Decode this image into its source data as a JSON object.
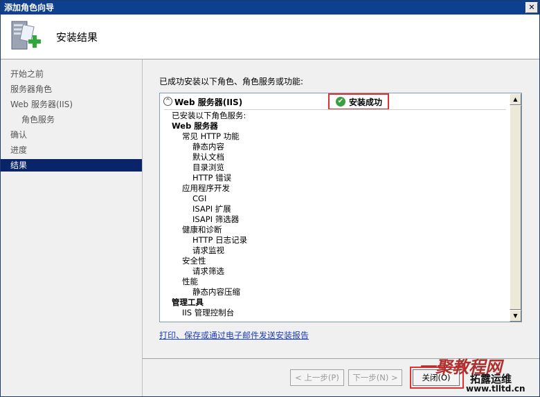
{
  "window": {
    "title": "添加角色向导",
    "close_glyph": "✕"
  },
  "header": {
    "title": "安装结果"
  },
  "sidebar": {
    "items": [
      {
        "label": "开始之前",
        "state": "normal",
        "indent": false
      },
      {
        "label": "服务器角色",
        "state": "normal",
        "indent": false
      },
      {
        "label": "Web 服务器(IIS)",
        "state": "normal",
        "indent": false
      },
      {
        "label": "角色服务",
        "state": "normal",
        "indent": true
      },
      {
        "label": "确认",
        "state": "normal",
        "indent": false
      },
      {
        "label": "进度",
        "state": "normal",
        "indent": false
      },
      {
        "label": "结果",
        "state": "active",
        "indent": false
      }
    ]
  },
  "main": {
    "intro": "已成功安装以下角色、角色服务或功能:",
    "section": {
      "collapse_glyph": "^",
      "title": "Web 服务器(IIS)",
      "status_text": "安装成功",
      "status_glyph": "✔"
    },
    "lines": [
      {
        "text": "已安装以下角色服务:",
        "level": 0,
        "bold": false
      },
      {
        "text": "Web 服务器",
        "level": 0,
        "bold": true
      },
      {
        "text": "常见 HTTP 功能",
        "level": 1,
        "bold": false
      },
      {
        "text": "静态内容",
        "level": 2,
        "bold": false
      },
      {
        "text": "默认文档",
        "level": 2,
        "bold": false
      },
      {
        "text": "目录浏览",
        "level": 2,
        "bold": false
      },
      {
        "text": "HTTP 错误",
        "level": 2,
        "bold": false
      },
      {
        "text": "应用程序开发",
        "level": 1,
        "bold": false
      },
      {
        "text": "CGI",
        "level": 2,
        "bold": false
      },
      {
        "text": "ISAPI 扩展",
        "level": 2,
        "bold": false
      },
      {
        "text": "ISAPI 筛选器",
        "level": 2,
        "bold": false
      },
      {
        "text": "健康和诊断",
        "level": 1,
        "bold": false
      },
      {
        "text": "HTTP 日志记录",
        "level": 2,
        "bold": false
      },
      {
        "text": "请求监视",
        "level": 2,
        "bold": false
      },
      {
        "text": "安全性",
        "level": 1,
        "bold": false
      },
      {
        "text": "请求筛选",
        "level": 2,
        "bold": false
      },
      {
        "text": "性能",
        "level": 1,
        "bold": false
      },
      {
        "text": "静态内容压缩",
        "level": 2,
        "bold": false
      },
      {
        "text": "管理工具",
        "level": 0,
        "bold": true
      },
      {
        "text": "IIS 管理控制台",
        "level": 1,
        "bold": false
      }
    ],
    "report_link": "打印、保存或通过电子邮件发送安装报告"
  },
  "footer": {
    "prev_label": "< 上一步(P)",
    "next_label": "下一步(N) >",
    "close_label": "关闭(O)",
    "prev_enabled": false,
    "next_enabled": false,
    "close_enabled": true
  },
  "scroll": {
    "up_glyph": "▲",
    "down_glyph": "▼"
  },
  "watermark": {
    "line1": "一聚教程网",
    "line2": "拓露运维",
    "line3": "www.tlltd.cn"
  },
  "colors": {
    "titlebar": "#0f3f8f",
    "nav_active": "#0a246a",
    "highlight_red": "#e03030",
    "success_green": "#3aa040",
    "link_blue": "#1a3cc0"
  }
}
